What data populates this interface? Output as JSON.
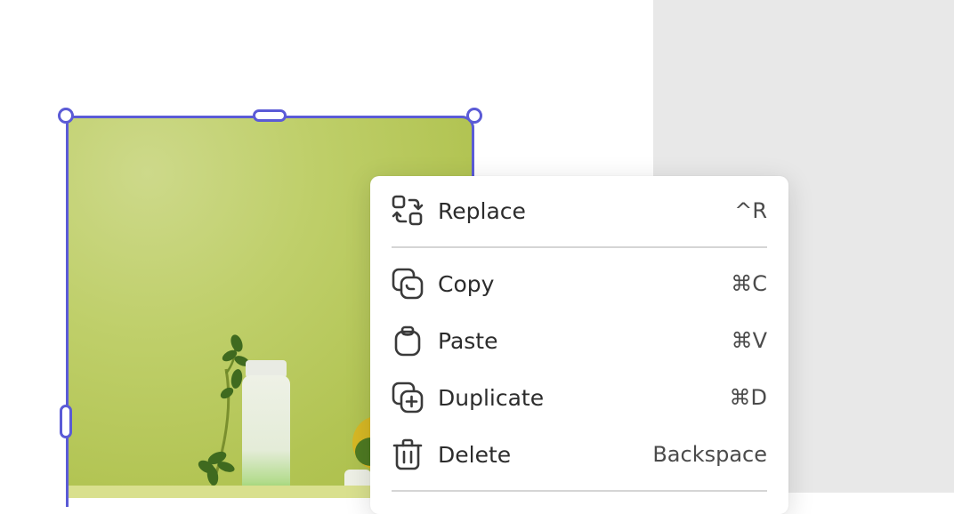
{
  "canvas": {
    "artboard_color": "#ffffff",
    "pasteboard_color": "#e8e8e8",
    "selection_color": "#5b5bd6"
  },
  "image": {
    "description_icon": "photo-icon"
  },
  "context_menu": {
    "items": [
      {
        "label": "Replace",
        "shortcut": "^R",
        "icon": "replace-icon"
      },
      {
        "label": "Copy",
        "shortcut": "⌘C",
        "icon": "copy-icon"
      },
      {
        "label": "Paste",
        "shortcut": "⌘V",
        "icon": "paste-icon"
      },
      {
        "label": "Duplicate",
        "shortcut": "⌘D",
        "icon": "duplicate-icon"
      },
      {
        "label": "Delete",
        "shortcut": "Backspace",
        "icon": "delete-icon"
      }
    ]
  }
}
